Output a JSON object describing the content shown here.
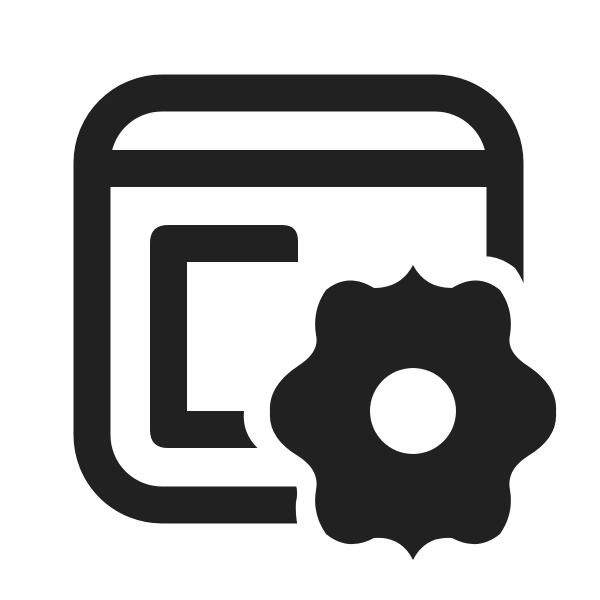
{
  "icon": {
    "name": "app-window-settings-icon",
    "parts": [
      "app-window-icon",
      "panel-icon",
      "gear-icon"
    ]
  },
  "colors": {
    "foreground": "#212121",
    "background": "#ffffff"
  }
}
